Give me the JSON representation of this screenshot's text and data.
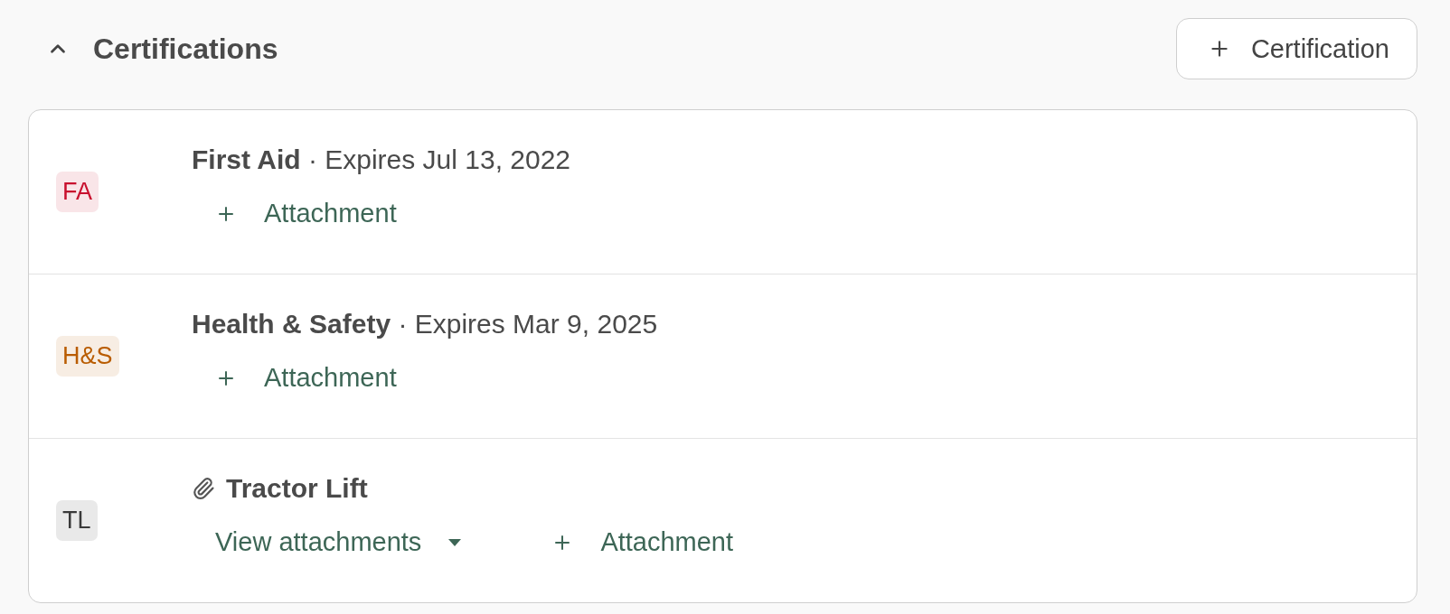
{
  "section": {
    "title": "Certifications",
    "expanded": true,
    "add_button": "Certification"
  },
  "certifications": [
    {
      "badge": "FA",
      "color": "#c8102e",
      "name": "First Aid",
      "detail": "· Expires Jul 13, 2022",
      "has_attachments": false,
      "attach_button": "Attachment"
    },
    {
      "badge": "H&S",
      "color": "#b95c00",
      "name": "Health & Safety",
      "detail": "· Expires Mar 9, 2025",
      "has_attachments": false,
      "attach_button": "Attachment"
    },
    {
      "badge": "TL",
      "color": "#3a3a3a",
      "name": "Tractor Lift",
      "has_attachments": true,
      "view_button": "View attachments",
      "attach_button": "Attachment"
    }
  ]
}
